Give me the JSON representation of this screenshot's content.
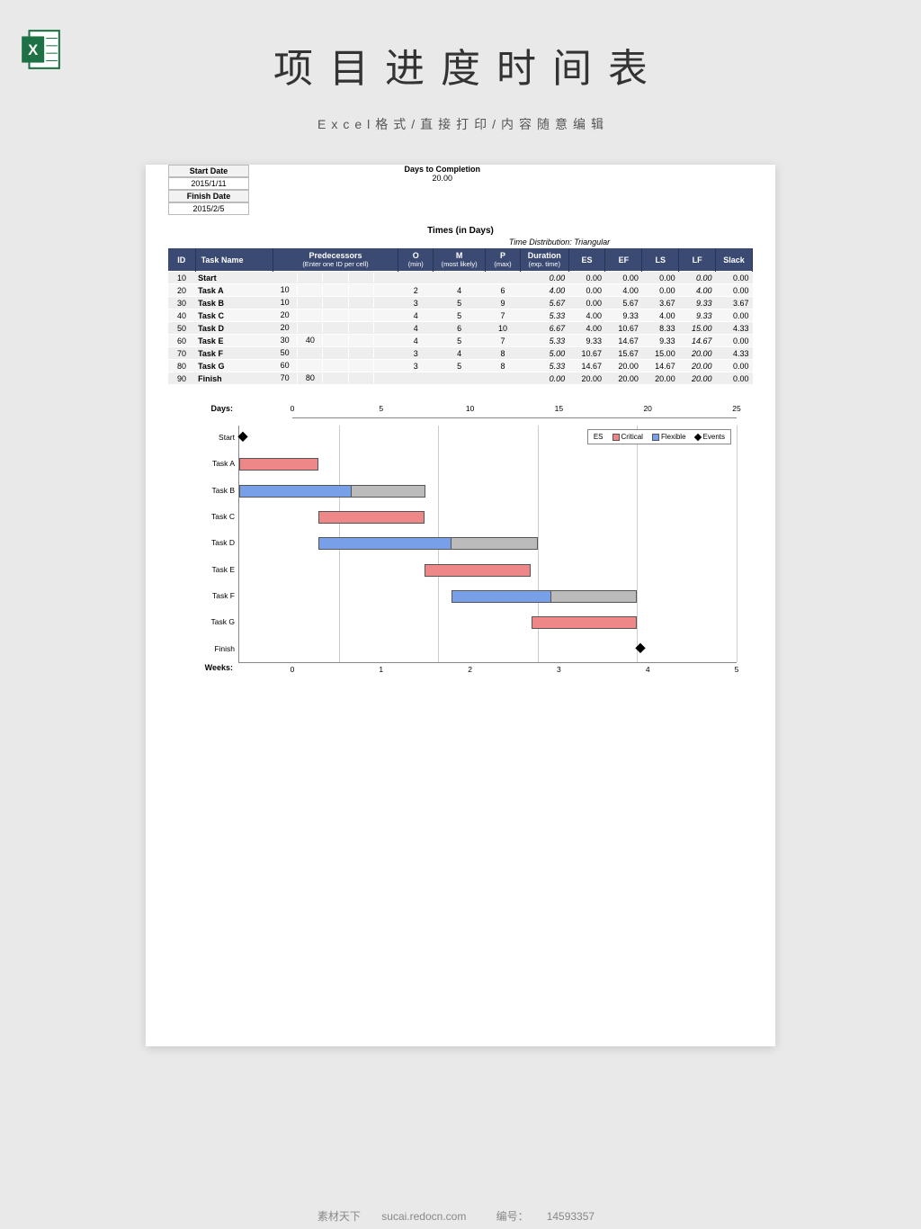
{
  "title": "项目进度时间表",
  "subtitle": "Excel格式/直接打印/内容随意编辑",
  "topinfo": {
    "start_date_label": "Start Date",
    "start_date": "2015/1/11",
    "finish_date_label": "Finish Date",
    "finish_date": "2015/2/5",
    "days_completion_label": "Days to Completion",
    "days_completion": "20.00"
  },
  "times_header": "Times (in Days)",
  "dist_label": "Time Distribution:",
  "dist_value": "Triangular",
  "columns": {
    "id": "ID",
    "task": "Task Name",
    "pred": "Predecessors",
    "pred_sub": "(Enter one ID per cell)",
    "o": "O",
    "o_sub": "(min)",
    "m": "M",
    "m_sub": "(most likely)",
    "p": "P",
    "p_sub": "(max)",
    "dur": "Duration",
    "dur_sub": "(exp. time)",
    "es": "ES",
    "ef": "EF",
    "ls": "LS",
    "lf": "LF",
    "slack": "Slack"
  },
  "rows": [
    {
      "id": "10",
      "name": "Start",
      "pred": [
        "",
        "",
        "",
        "",
        ""
      ],
      "o": "",
      "m": "",
      "p": "",
      "dur": "0.00",
      "es": "0.00",
      "ef": "0.00",
      "ls": "0.00",
      "lf": "0.00",
      "slack": "0.00"
    },
    {
      "id": "20",
      "name": "Task A",
      "pred": [
        "10",
        "",
        "",
        "",
        ""
      ],
      "o": "2",
      "m": "4",
      "p": "6",
      "dur": "4.00",
      "es": "0.00",
      "ef": "4.00",
      "ls": "0.00",
      "lf": "4.00",
      "slack": "0.00"
    },
    {
      "id": "30",
      "name": "Task B",
      "pred": [
        "10",
        "",
        "",
        "",
        ""
      ],
      "o": "3",
      "m": "5",
      "p": "9",
      "dur": "5.67",
      "es": "0.00",
      "ef": "5.67",
      "ls": "3.67",
      "lf": "9.33",
      "slack": "3.67"
    },
    {
      "id": "40",
      "name": "Task C",
      "pred": [
        "20",
        "",
        "",
        "",
        ""
      ],
      "o": "4",
      "m": "5",
      "p": "7",
      "dur": "5.33",
      "es": "4.00",
      "ef": "9.33",
      "ls": "4.00",
      "lf": "9.33",
      "slack": "0.00"
    },
    {
      "id": "50",
      "name": "Task D",
      "pred": [
        "20",
        "",
        "",
        "",
        ""
      ],
      "o": "4",
      "m": "6",
      "p": "10",
      "dur": "6.67",
      "es": "4.00",
      "ef": "10.67",
      "ls": "8.33",
      "lf": "15.00",
      "slack": "4.33"
    },
    {
      "id": "60",
      "name": "Task E",
      "pred": [
        "30",
        "40",
        "",
        "",
        ""
      ],
      "o": "4",
      "m": "5",
      "p": "7",
      "dur": "5.33",
      "es": "9.33",
      "ef": "14.67",
      "ls": "9.33",
      "lf": "14.67",
      "slack": "0.00"
    },
    {
      "id": "70",
      "name": "Task F",
      "pred": [
        "50",
        "",
        "",
        "",
        ""
      ],
      "o": "3",
      "m": "4",
      "p": "8",
      "dur": "5.00",
      "es": "10.67",
      "ef": "15.67",
      "ls": "15.00",
      "lf": "20.00",
      "slack": "4.33"
    },
    {
      "id": "80",
      "name": "Task G",
      "pred": [
        "60",
        "",
        "",
        "",
        ""
      ],
      "o": "3",
      "m": "5",
      "p": "8",
      "dur": "5.33",
      "es": "14.67",
      "ef": "20.00",
      "ls": "14.67",
      "lf": "20.00",
      "slack": "0.00"
    },
    {
      "id": "90",
      "name": "Finish",
      "pred": [
        "70",
        "80",
        "",
        "",
        ""
      ],
      "o": "",
      "m": "",
      "p": "",
      "dur": "0.00",
      "es": "20.00",
      "ef": "20.00",
      "ls": "20.00",
      "lf": "20.00",
      "slack": "0.00"
    }
  ],
  "chart_data": {
    "type": "bar",
    "title": "Gantt",
    "xlabel_top": "Days:",
    "xlabel_bottom": "Weeks:",
    "days_ticks": [
      0,
      5,
      10,
      15,
      20,
      25
    ],
    "weeks_ticks": [
      0,
      1,
      2,
      3,
      4,
      5
    ],
    "x_max": 25,
    "legend": {
      "es": "ES",
      "critical": "Critical",
      "flexible": "Flexible",
      "events": "Events"
    },
    "tasks": [
      {
        "name": "Start",
        "es": 0,
        "dur": 0,
        "slack": 0,
        "kind": "event"
      },
      {
        "name": "Task A",
        "es": 0,
        "dur": 4.0,
        "slack": 0,
        "kind": "critical"
      },
      {
        "name": "Task B",
        "es": 0,
        "dur": 5.67,
        "slack": 3.67,
        "kind": "flexible"
      },
      {
        "name": "Task C",
        "es": 4.0,
        "dur": 5.33,
        "slack": 0,
        "kind": "critical"
      },
      {
        "name": "Task D",
        "es": 4.0,
        "dur": 6.67,
        "slack": 4.33,
        "kind": "flexible"
      },
      {
        "name": "Task E",
        "es": 9.33,
        "dur": 5.33,
        "slack": 0,
        "kind": "critical"
      },
      {
        "name": "Task F",
        "es": 10.67,
        "dur": 5.0,
        "slack": 4.33,
        "kind": "flexible"
      },
      {
        "name": "Task G",
        "es": 14.67,
        "dur": 5.33,
        "slack": 0,
        "kind": "critical"
      },
      {
        "name": "Finish",
        "es": 20.0,
        "dur": 0,
        "slack": 0,
        "kind": "event"
      }
    ]
  },
  "footer": {
    "site_label": "素材天下",
    "site": "sucai.redocn.com",
    "code_label": "编号：",
    "code": "14593357"
  }
}
